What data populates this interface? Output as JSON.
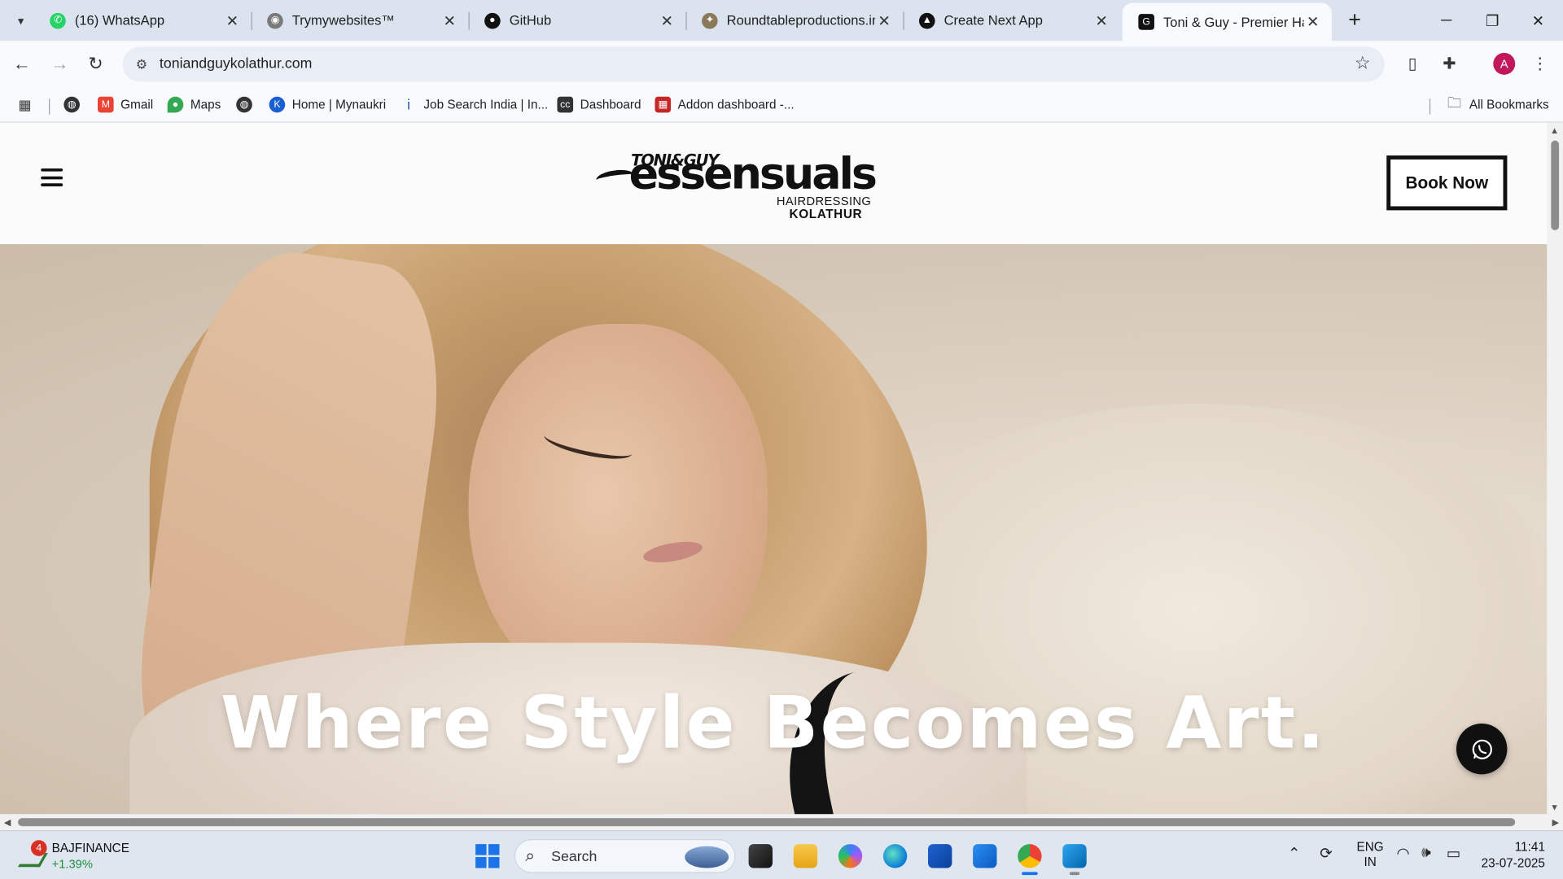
{
  "browser": {
    "tabs": [
      {
        "title": "(16) WhatsApp",
        "icon": "whatsapp-icon",
        "color": "#25d366"
      },
      {
        "title": "Trymywebsites™",
        "icon": "site-icon",
        "color": "#6b6b6b"
      },
      {
        "title": "GitHub",
        "icon": "github-icon",
        "color": "#111111"
      },
      {
        "title": "Roundtableproductions.in",
        "icon": "roundtable-icon",
        "color": "#8a7a5a"
      },
      {
        "title": "Create Next App",
        "icon": "nextjs-icon",
        "color": "#111111"
      },
      {
        "title": "Toni & Guy - Premier Hair",
        "icon": "toni-guy-icon",
        "color": "#111111",
        "active": true
      }
    ],
    "url": "toniandguykolathur.com",
    "profile_initial": "A",
    "bookmarks": [
      {
        "label": "",
        "icon": "globe-icon"
      },
      {
        "label": "Gmail",
        "icon": "gmail-icon"
      },
      {
        "label": "Maps",
        "icon": "maps-icon"
      },
      {
        "label": "",
        "icon": "globe-icon"
      },
      {
        "label": "Home | Mynaukri",
        "icon": "mynaukri-icon"
      },
      {
        "label": "Job Search India | In...",
        "icon": "indeed-icon"
      },
      {
        "label": "Dashboard",
        "icon": "cc-icon"
      },
      {
        "label": "Addon dashboard -...",
        "icon": "addon-icon"
      }
    ],
    "all_bookmarks_label": "All Bookmarks"
  },
  "site": {
    "logo": {
      "brand_small": "TONI&GUY",
      "brand_large": "essensuals",
      "line1": "HAIRDRESSING",
      "line2": "KOLATHUR"
    },
    "book_button": "Book Now",
    "hero_title": "Where Style Becomes Art."
  },
  "taskbar": {
    "stock_name": "BAJFINANCE",
    "stock_change": "+1.39%",
    "stock_badge": "4",
    "search_label": "Search",
    "lang_line1": "ENG",
    "lang_line2": "IN",
    "time": "11:41",
    "date": "23-07-2025"
  },
  "colors": {
    "accent": "#1a73e8",
    "whatsapp_button": "#101010",
    "stock_up": "#1e8e3e"
  }
}
